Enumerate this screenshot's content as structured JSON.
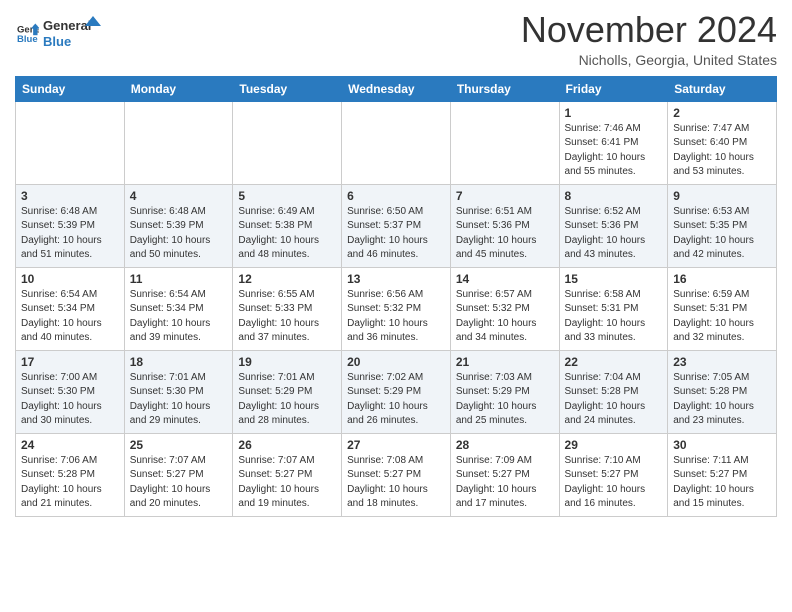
{
  "header": {
    "logo": {
      "line1": "General",
      "line2": "Blue"
    },
    "month": "November 2024",
    "location": "Nicholls, Georgia, United States"
  },
  "weekdays": [
    "Sunday",
    "Monday",
    "Tuesday",
    "Wednesday",
    "Thursday",
    "Friday",
    "Saturday"
  ],
  "weeks": [
    [
      {
        "day": "",
        "sunrise": "",
        "sunset": "",
        "daylight": ""
      },
      {
        "day": "",
        "sunrise": "",
        "sunset": "",
        "daylight": ""
      },
      {
        "day": "",
        "sunrise": "",
        "sunset": "",
        "daylight": ""
      },
      {
        "day": "",
        "sunrise": "",
        "sunset": "",
        "daylight": ""
      },
      {
        "day": "",
        "sunrise": "",
        "sunset": "",
        "daylight": ""
      },
      {
        "day": "1",
        "sunrise": "Sunrise: 7:46 AM",
        "sunset": "Sunset: 6:41 PM",
        "daylight": "Daylight: 10 hours and 55 minutes."
      },
      {
        "day": "2",
        "sunrise": "Sunrise: 7:47 AM",
        "sunset": "Sunset: 6:40 PM",
        "daylight": "Daylight: 10 hours and 53 minutes."
      }
    ],
    [
      {
        "day": "3",
        "sunrise": "Sunrise: 6:48 AM",
        "sunset": "Sunset: 5:39 PM",
        "daylight": "Daylight: 10 hours and 51 minutes."
      },
      {
        "day": "4",
        "sunrise": "Sunrise: 6:48 AM",
        "sunset": "Sunset: 5:39 PM",
        "daylight": "Daylight: 10 hours and 50 minutes."
      },
      {
        "day": "5",
        "sunrise": "Sunrise: 6:49 AM",
        "sunset": "Sunset: 5:38 PM",
        "daylight": "Daylight: 10 hours and 48 minutes."
      },
      {
        "day": "6",
        "sunrise": "Sunrise: 6:50 AM",
        "sunset": "Sunset: 5:37 PM",
        "daylight": "Daylight: 10 hours and 46 minutes."
      },
      {
        "day": "7",
        "sunrise": "Sunrise: 6:51 AM",
        "sunset": "Sunset: 5:36 PM",
        "daylight": "Daylight: 10 hours and 45 minutes."
      },
      {
        "day": "8",
        "sunrise": "Sunrise: 6:52 AM",
        "sunset": "Sunset: 5:36 PM",
        "daylight": "Daylight: 10 hours and 43 minutes."
      },
      {
        "day": "9",
        "sunrise": "Sunrise: 6:53 AM",
        "sunset": "Sunset: 5:35 PM",
        "daylight": "Daylight: 10 hours and 42 minutes."
      }
    ],
    [
      {
        "day": "10",
        "sunrise": "Sunrise: 6:54 AM",
        "sunset": "Sunset: 5:34 PM",
        "daylight": "Daylight: 10 hours and 40 minutes."
      },
      {
        "day": "11",
        "sunrise": "Sunrise: 6:54 AM",
        "sunset": "Sunset: 5:34 PM",
        "daylight": "Daylight: 10 hours and 39 minutes."
      },
      {
        "day": "12",
        "sunrise": "Sunrise: 6:55 AM",
        "sunset": "Sunset: 5:33 PM",
        "daylight": "Daylight: 10 hours and 37 minutes."
      },
      {
        "day": "13",
        "sunrise": "Sunrise: 6:56 AM",
        "sunset": "Sunset: 5:32 PM",
        "daylight": "Daylight: 10 hours and 36 minutes."
      },
      {
        "day": "14",
        "sunrise": "Sunrise: 6:57 AM",
        "sunset": "Sunset: 5:32 PM",
        "daylight": "Daylight: 10 hours and 34 minutes."
      },
      {
        "day": "15",
        "sunrise": "Sunrise: 6:58 AM",
        "sunset": "Sunset: 5:31 PM",
        "daylight": "Daylight: 10 hours and 33 minutes."
      },
      {
        "day": "16",
        "sunrise": "Sunrise: 6:59 AM",
        "sunset": "Sunset: 5:31 PM",
        "daylight": "Daylight: 10 hours and 32 minutes."
      }
    ],
    [
      {
        "day": "17",
        "sunrise": "Sunrise: 7:00 AM",
        "sunset": "Sunset: 5:30 PM",
        "daylight": "Daylight: 10 hours and 30 minutes."
      },
      {
        "day": "18",
        "sunrise": "Sunrise: 7:01 AM",
        "sunset": "Sunset: 5:30 PM",
        "daylight": "Daylight: 10 hours and 29 minutes."
      },
      {
        "day": "19",
        "sunrise": "Sunrise: 7:01 AM",
        "sunset": "Sunset: 5:29 PM",
        "daylight": "Daylight: 10 hours and 28 minutes."
      },
      {
        "day": "20",
        "sunrise": "Sunrise: 7:02 AM",
        "sunset": "Sunset: 5:29 PM",
        "daylight": "Daylight: 10 hours and 26 minutes."
      },
      {
        "day": "21",
        "sunrise": "Sunrise: 7:03 AM",
        "sunset": "Sunset: 5:29 PM",
        "daylight": "Daylight: 10 hours and 25 minutes."
      },
      {
        "day": "22",
        "sunrise": "Sunrise: 7:04 AM",
        "sunset": "Sunset: 5:28 PM",
        "daylight": "Daylight: 10 hours and 24 minutes."
      },
      {
        "day": "23",
        "sunrise": "Sunrise: 7:05 AM",
        "sunset": "Sunset: 5:28 PM",
        "daylight": "Daylight: 10 hours and 23 minutes."
      }
    ],
    [
      {
        "day": "24",
        "sunrise": "Sunrise: 7:06 AM",
        "sunset": "Sunset: 5:28 PM",
        "daylight": "Daylight: 10 hours and 21 minutes."
      },
      {
        "day": "25",
        "sunrise": "Sunrise: 7:07 AM",
        "sunset": "Sunset: 5:27 PM",
        "daylight": "Daylight: 10 hours and 20 minutes."
      },
      {
        "day": "26",
        "sunrise": "Sunrise: 7:07 AM",
        "sunset": "Sunset: 5:27 PM",
        "daylight": "Daylight: 10 hours and 19 minutes."
      },
      {
        "day": "27",
        "sunrise": "Sunrise: 7:08 AM",
        "sunset": "Sunset: 5:27 PM",
        "daylight": "Daylight: 10 hours and 18 minutes."
      },
      {
        "day": "28",
        "sunrise": "Sunrise: 7:09 AM",
        "sunset": "Sunset: 5:27 PM",
        "daylight": "Daylight: 10 hours and 17 minutes."
      },
      {
        "day": "29",
        "sunrise": "Sunrise: 7:10 AM",
        "sunset": "Sunset: 5:27 PM",
        "daylight": "Daylight: 10 hours and 16 minutes."
      },
      {
        "day": "30",
        "sunrise": "Sunrise: 7:11 AM",
        "sunset": "Sunset: 5:27 PM",
        "daylight": "Daylight: 10 hours and 15 minutes."
      }
    ]
  ]
}
